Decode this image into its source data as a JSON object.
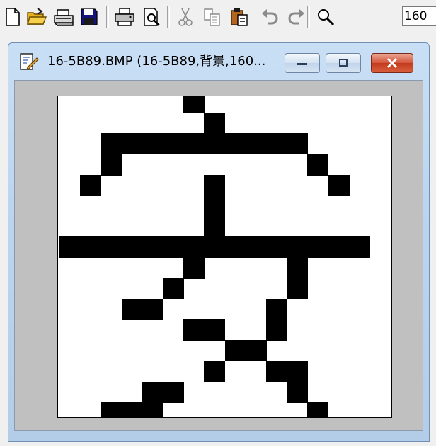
{
  "toolbar": {
    "buttons": [
      {
        "name": "new-file-button",
        "icon": "new-document-icon"
      },
      {
        "name": "open-file-button",
        "icon": "open-folder-icon"
      },
      {
        "name": "scan-button",
        "icon": "scanner-icon"
      },
      {
        "name": "save-button",
        "icon": "floppy-disk-icon"
      },
      {
        "name": "print-button",
        "icon": "printer-icon"
      },
      {
        "name": "print-preview-button",
        "icon": "print-preview-icon"
      },
      {
        "name": "cut-button",
        "icon": "scissors-icon"
      },
      {
        "name": "copy-button",
        "icon": "copy-icon"
      },
      {
        "name": "paste-button",
        "icon": "clipboard-icon"
      },
      {
        "name": "undo-button",
        "icon": "undo-arrow-icon"
      },
      {
        "name": "redo-button",
        "icon": "redo-arrow-icon"
      },
      {
        "name": "zoom-button",
        "icon": "magnifier-icon"
      }
    ],
    "zoom_value": "160"
  },
  "window": {
    "title": "16-5B89.BMP (16-5B89,背景,160...",
    "accent_color": "#cc4126"
  },
  "bitmap": {
    "grid_columns": 16,
    "grid_rows": 16,
    "pixel_color": "#000000",
    "background_color": "#ffffff",
    "rows": [
      "......#.........",
      ".......#........",
      "..##########....",
      "..#.........#...",
      ".#.....#.....#..",
      ".......#........",
      ".......#........",
      "###############.",
      "......#....#....",
      ".....#.....#....",
      "...##.....#.....",
      "......##..#.....",
      "........##......",
      ".......#..##....",
      "....##.....#....",
      "..###.......#..."
    ]
  }
}
